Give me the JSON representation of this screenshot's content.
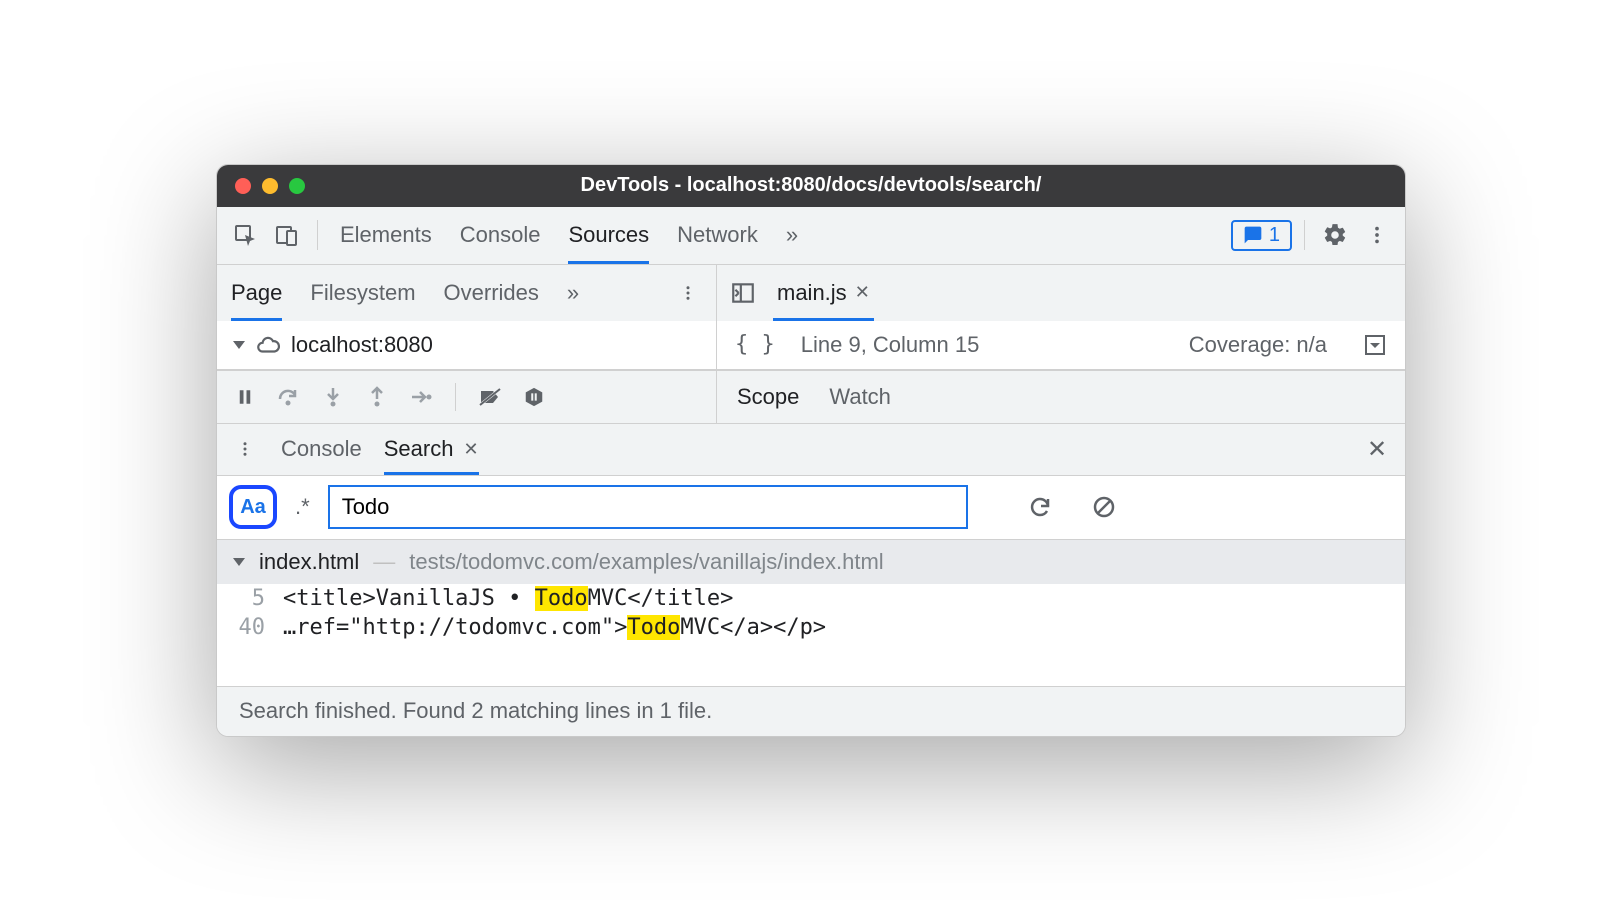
{
  "window": {
    "title": "DevTools - localhost:8080/docs/devtools/search/"
  },
  "main_tabs": {
    "elements": "Elements",
    "console": "Console",
    "sources": "Sources",
    "network": "Network",
    "overflow": "»"
  },
  "feedback": {
    "count": "1"
  },
  "sources_left_tabs": {
    "page": "Page",
    "filesystem": "Filesystem",
    "overrides": "Overrides",
    "overflow": "»"
  },
  "file_tree": {
    "host": "localhost:8080"
  },
  "editor": {
    "file_tab": "main.js",
    "format_hint": "{ }",
    "cursor": "Line 9, Column 15",
    "coverage": "Coverage: n/a"
  },
  "debug_right_tabs": {
    "scope": "Scope",
    "watch": "Watch"
  },
  "drawer_tabs": {
    "console": "Console",
    "search": "Search"
  },
  "search": {
    "case_label": "Aa",
    "regex_label": ".*",
    "query": "Todo"
  },
  "results": {
    "file_name": "index.html",
    "file_path": "tests/todomvc.com/examples/vanillajs/index.html",
    "lines": [
      {
        "no": "5",
        "pre": "<title>VanillaJS • ",
        "match": "Todo",
        "post": "MVC</title>"
      },
      {
        "no": "40",
        "pre": "…ref=\"http://todomvc.com\">",
        "match": "Todo",
        "post": "MVC</a></p>"
      }
    ]
  },
  "footer": {
    "status": "Search finished.  Found 2 matching lines in 1 file."
  }
}
